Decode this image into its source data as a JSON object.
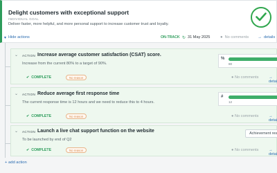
{
  "goal": {
    "title": "Delight customers with exceptional support",
    "type": "INDIVIDUAL GOAL",
    "description": "Deliver faster, more helpful, and more personal support to increase customer trust and loyalty.",
    "hide_actions": "Hide actions",
    "status": "ON-TRACK",
    "date": "31 May 2025",
    "comments": "No comments",
    "details": "details",
    "status_color": "#2d9c5b"
  },
  "actions": [
    {
      "label": "ACTION",
      "title": "Increase average customer satisfaction (CSAT) score.",
      "description": "Increase from the current 80% to a target of 90%.",
      "status": "COMPLETE",
      "badge": "No reason",
      "comments": "No comments",
      "details": "details",
      "progress": {
        "icon": "%",
        "min": "80",
        "max": "90",
        "fill": 1.0
      }
    },
    {
      "label": "ACTION",
      "title": "Reduce average first response time",
      "description": "The current response time is 12 hours and we need to reduce this to 4 hours.",
      "status": "COMPLETE",
      "badge": "No reason",
      "comments": "No comments",
      "details": "details",
      "progress": {
        "icon": "#",
        "min": "12",
        "max": "4",
        "fill": 1.0
      }
    },
    {
      "label": "ACTION",
      "title": "Launch a live chat support function on the website",
      "description": "To be launched by end of Q2",
      "status": "COMPLETE",
      "badge": "No reason",
      "comments": "No comments",
      "details": "details",
      "achievement_button": "Achievement result"
    }
  ],
  "add_action": "+ add action",
  "icons": [
    "check-circle-icon",
    "chevron-down-icon",
    "calendar-icon",
    "comment-icon",
    "arrow-right-icon",
    "collapse-icon",
    "percent-icon",
    "hash-icon"
  ],
  "accent": "#2d9c5b",
  "link_color": "#2b6cb0"
}
